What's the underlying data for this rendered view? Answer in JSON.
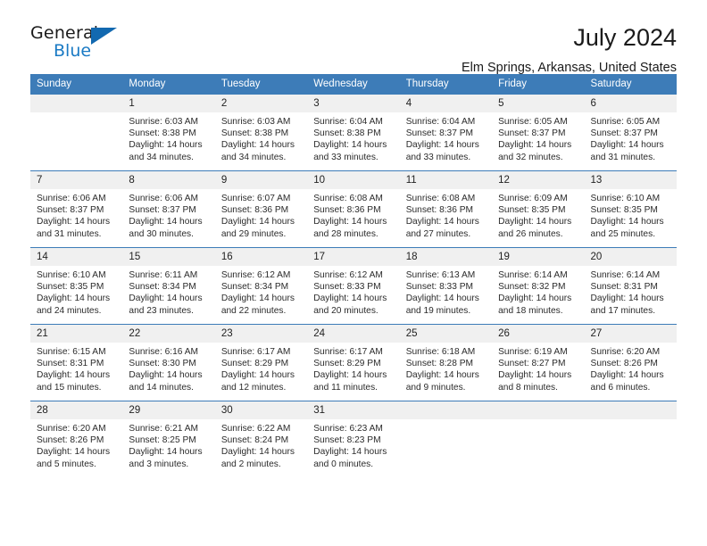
{
  "brand": {
    "name_top": "General",
    "name_bottom": "Blue",
    "triangle_color": "#1269b0",
    "blue_text_color": "#1a7ac4"
  },
  "header": {
    "title": "July 2024",
    "subtitle": "Elm Springs, Arkansas, United States"
  },
  "theme": {
    "header_bar_color": "#3d7cb8",
    "daynum_band_color": "#f0f0f0",
    "text_color": "#2b2b2b"
  },
  "calendar": {
    "weekdays": [
      "Sunday",
      "Monday",
      "Tuesday",
      "Wednesday",
      "Thursday",
      "Friday",
      "Saturday"
    ],
    "weeks": [
      [
        {
          "day": "",
          "empty": true,
          "sunrise": "",
          "sunset": "",
          "daylight_line1": "",
          "daylight_line2": ""
        },
        {
          "day": "1",
          "sunrise": "Sunrise: 6:03 AM",
          "sunset": "Sunset: 8:38 PM",
          "daylight_line1": "Daylight: 14 hours",
          "daylight_line2": "and 34 minutes."
        },
        {
          "day": "2",
          "sunrise": "Sunrise: 6:03 AM",
          "sunset": "Sunset: 8:38 PM",
          "daylight_line1": "Daylight: 14 hours",
          "daylight_line2": "and 34 minutes."
        },
        {
          "day": "3",
          "sunrise": "Sunrise: 6:04 AM",
          "sunset": "Sunset: 8:38 PM",
          "daylight_line1": "Daylight: 14 hours",
          "daylight_line2": "and 33 minutes."
        },
        {
          "day": "4",
          "sunrise": "Sunrise: 6:04 AM",
          "sunset": "Sunset: 8:37 PM",
          "daylight_line1": "Daylight: 14 hours",
          "daylight_line2": "and 33 minutes."
        },
        {
          "day": "5",
          "sunrise": "Sunrise: 6:05 AM",
          "sunset": "Sunset: 8:37 PM",
          "daylight_line1": "Daylight: 14 hours",
          "daylight_line2": "and 32 minutes."
        },
        {
          "day": "6",
          "sunrise": "Sunrise: 6:05 AM",
          "sunset": "Sunset: 8:37 PM",
          "daylight_line1": "Daylight: 14 hours",
          "daylight_line2": "and 31 minutes."
        }
      ],
      [
        {
          "day": "7",
          "sunrise": "Sunrise: 6:06 AM",
          "sunset": "Sunset: 8:37 PM",
          "daylight_line1": "Daylight: 14 hours",
          "daylight_line2": "and 31 minutes."
        },
        {
          "day": "8",
          "sunrise": "Sunrise: 6:06 AM",
          "sunset": "Sunset: 8:37 PM",
          "daylight_line1": "Daylight: 14 hours",
          "daylight_line2": "and 30 minutes."
        },
        {
          "day": "9",
          "sunrise": "Sunrise: 6:07 AM",
          "sunset": "Sunset: 8:36 PM",
          "daylight_line1": "Daylight: 14 hours",
          "daylight_line2": "and 29 minutes."
        },
        {
          "day": "10",
          "sunrise": "Sunrise: 6:08 AM",
          "sunset": "Sunset: 8:36 PM",
          "daylight_line1": "Daylight: 14 hours",
          "daylight_line2": "and 28 minutes."
        },
        {
          "day": "11",
          "sunrise": "Sunrise: 6:08 AM",
          "sunset": "Sunset: 8:36 PM",
          "daylight_line1": "Daylight: 14 hours",
          "daylight_line2": "and 27 minutes."
        },
        {
          "day": "12",
          "sunrise": "Sunrise: 6:09 AM",
          "sunset": "Sunset: 8:35 PM",
          "daylight_line1": "Daylight: 14 hours",
          "daylight_line2": "and 26 minutes."
        },
        {
          "day": "13",
          "sunrise": "Sunrise: 6:10 AM",
          "sunset": "Sunset: 8:35 PM",
          "daylight_line1": "Daylight: 14 hours",
          "daylight_line2": "and 25 minutes."
        }
      ],
      [
        {
          "day": "14",
          "sunrise": "Sunrise: 6:10 AM",
          "sunset": "Sunset: 8:35 PM",
          "daylight_line1": "Daylight: 14 hours",
          "daylight_line2": "and 24 minutes."
        },
        {
          "day": "15",
          "sunrise": "Sunrise: 6:11 AM",
          "sunset": "Sunset: 8:34 PM",
          "daylight_line1": "Daylight: 14 hours",
          "daylight_line2": "and 23 minutes."
        },
        {
          "day": "16",
          "sunrise": "Sunrise: 6:12 AM",
          "sunset": "Sunset: 8:34 PM",
          "daylight_line1": "Daylight: 14 hours",
          "daylight_line2": "and 22 minutes."
        },
        {
          "day": "17",
          "sunrise": "Sunrise: 6:12 AM",
          "sunset": "Sunset: 8:33 PM",
          "daylight_line1": "Daylight: 14 hours",
          "daylight_line2": "and 20 minutes."
        },
        {
          "day": "18",
          "sunrise": "Sunrise: 6:13 AM",
          "sunset": "Sunset: 8:33 PM",
          "daylight_line1": "Daylight: 14 hours",
          "daylight_line2": "and 19 minutes."
        },
        {
          "day": "19",
          "sunrise": "Sunrise: 6:14 AM",
          "sunset": "Sunset: 8:32 PM",
          "daylight_line1": "Daylight: 14 hours",
          "daylight_line2": "and 18 minutes."
        },
        {
          "day": "20",
          "sunrise": "Sunrise: 6:14 AM",
          "sunset": "Sunset: 8:31 PM",
          "daylight_line1": "Daylight: 14 hours",
          "daylight_line2": "and 17 minutes."
        }
      ],
      [
        {
          "day": "21",
          "sunrise": "Sunrise: 6:15 AM",
          "sunset": "Sunset: 8:31 PM",
          "daylight_line1": "Daylight: 14 hours",
          "daylight_line2": "and 15 minutes."
        },
        {
          "day": "22",
          "sunrise": "Sunrise: 6:16 AM",
          "sunset": "Sunset: 8:30 PM",
          "daylight_line1": "Daylight: 14 hours",
          "daylight_line2": "and 14 minutes."
        },
        {
          "day": "23",
          "sunrise": "Sunrise: 6:17 AM",
          "sunset": "Sunset: 8:29 PM",
          "daylight_line1": "Daylight: 14 hours",
          "daylight_line2": "and 12 minutes."
        },
        {
          "day": "24",
          "sunrise": "Sunrise: 6:17 AM",
          "sunset": "Sunset: 8:29 PM",
          "daylight_line1": "Daylight: 14 hours",
          "daylight_line2": "and 11 minutes."
        },
        {
          "day": "25",
          "sunrise": "Sunrise: 6:18 AM",
          "sunset": "Sunset: 8:28 PM",
          "daylight_line1": "Daylight: 14 hours",
          "daylight_line2": "and 9 minutes."
        },
        {
          "day": "26",
          "sunrise": "Sunrise: 6:19 AM",
          "sunset": "Sunset: 8:27 PM",
          "daylight_line1": "Daylight: 14 hours",
          "daylight_line2": "and 8 minutes."
        },
        {
          "day": "27",
          "sunrise": "Sunrise: 6:20 AM",
          "sunset": "Sunset: 8:26 PM",
          "daylight_line1": "Daylight: 14 hours",
          "daylight_line2": "and 6 minutes."
        }
      ],
      [
        {
          "day": "28",
          "sunrise": "Sunrise: 6:20 AM",
          "sunset": "Sunset: 8:26 PM",
          "daylight_line1": "Daylight: 14 hours",
          "daylight_line2": "and 5 minutes."
        },
        {
          "day": "29",
          "sunrise": "Sunrise: 6:21 AM",
          "sunset": "Sunset: 8:25 PM",
          "daylight_line1": "Daylight: 14 hours",
          "daylight_line2": "and 3 minutes."
        },
        {
          "day": "30",
          "sunrise": "Sunrise: 6:22 AM",
          "sunset": "Sunset: 8:24 PM",
          "daylight_line1": "Daylight: 14 hours",
          "daylight_line2": "and 2 minutes."
        },
        {
          "day": "31",
          "sunrise": "Sunrise: 6:23 AM",
          "sunset": "Sunset: 8:23 PM",
          "daylight_line1": "Daylight: 14 hours",
          "daylight_line2": "and 0 minutes."
        },
        {
          "day": "",
          "empty": true,
          "sunrise": "",
          "sunset": "",
          "daylight_line1": "",
          "daylight_line2": ""
        },
        {
          "day": "",
          "empty": true,
          "sunrise": "",
          "sunset": "",
          "daylight_line1": "",
          "daylight_line2": ""
        },
        {
          "day": "",
          "empty": true,
          "sunrise": "",
          "sunset": "",
          "daylight_line1": "",
          "daylight_line2": ""
        }
      ]
    ]
  }
}
